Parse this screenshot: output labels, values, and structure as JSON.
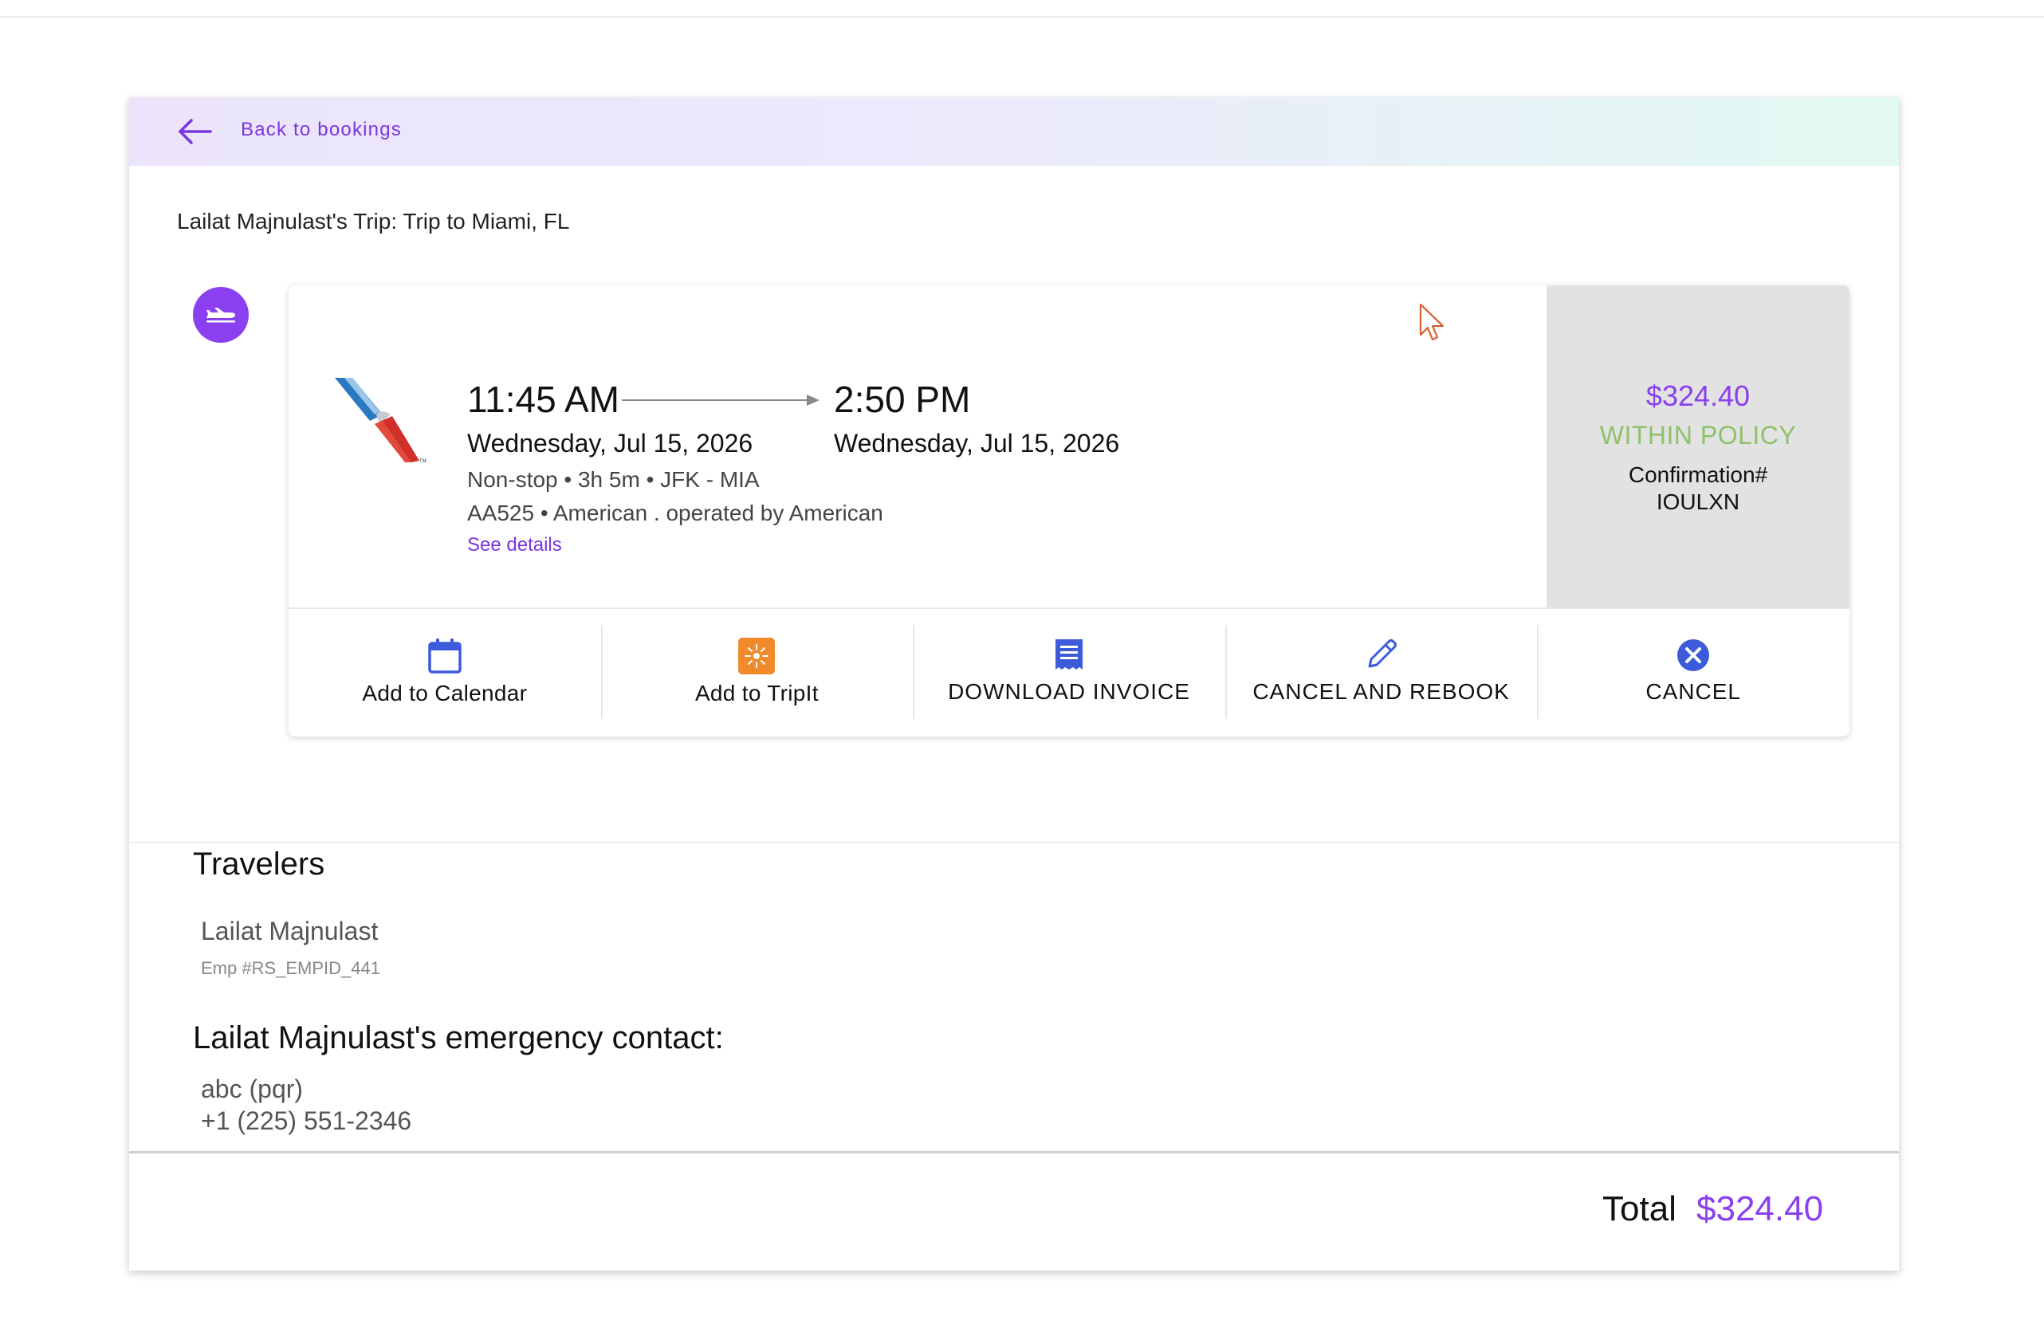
{
  "header": {
    "back_label": "Back to bookings"
  },
  "trip": {
    "title": "Lailat Majnulast's Trip: Trip to Miami, FL"
  },
  "flight": {
    "departure_time": "11:45 AM",
    "arrival_time": "2:50 PM",
    "departure_date": "Wednesday, Jul 15, 2026",
    "arrival_date": "Wednesday, Jul 15, 2026",
    "summary": "Non-stop • 3h 5m • JFK - MIA",
    "carrier_line": "AA525 • American . operated by American",
    "details_link": "See details",
    "airline_logo": "american-airlines-logo"
  },
  "pricing": {
    "price": "$324.40",
    "policy_status": "WITHIN POLICY",
    "confirmation_label": "Confirmation#",
    "confirmation_code": "IOULXN"
  },
  "actions": [
    {
      "label": "Add to Calendar",
      "icon": "calendar-icon"
    },
    {
      "label": "Add to TripIt",
      "icon": "tripit-icon"
    },
    {
      "label": "DOWNLOAD INVOICE",
      "icon": "invoice-icon"
    },
    {
      "label": "CANCEL AND REBOOK",
      "icon": "pencil-icon"
    },
    {
      "label": "CANCEL",
      "icon": "close-circle-icon"
    }
  ],
  "travelers": {
    "heading": "Travelers",
    "name": "Lailat Majnulast",
    "employee_id": "Emp #RS_EMPID_441"
  },
  "emergency_contact": {
    "heading": "Lailat Majnulast's emergency contact:",
    "name": "abc (pqr)",
    "phone": "+1 (225) 551-2346"
  },
  "total": {
    "label": "Total",
    "value": "$324.40"
  },
  "colors": {
    "accent": "#8a3ff0",
    "link": "#7b35e0",
    "policy_ok": "#8fc16a",
    "action_icon_blue": "#3b5bdb",
    "tripit_orange": "#f08a2b"
  }
}
